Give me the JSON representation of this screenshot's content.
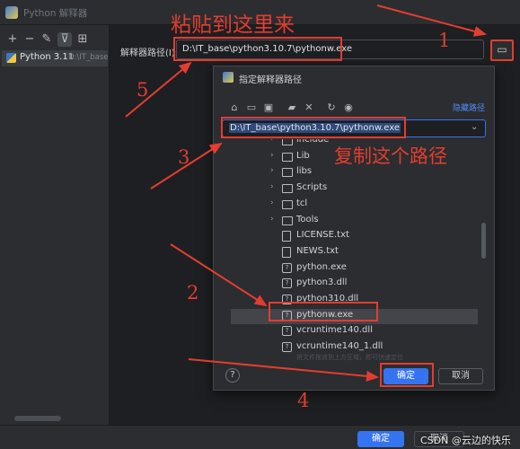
{
  "window": {
    "title": "Python 解释器"
  },
  "sidebar": {
    "interpreter": {
      "name": "Python 3.11",
      "path": "D:\\IT_base\\"
    }
  },
  "main": {
    "path_label": "解释器路径(I):",
    "path_value": "D:\\IT_base\\python3.10.7\\pythonw.exe"
  },
  "footer": {
    "ok_label": "确定",
    "cancel_label": "取消"
  },
  "dialog": {
    "title": "指定解释器路径",
    "hide_path_label": "隐藏路径",
    "path_value": "D:\\IT_base\\python3.10.7\\pythonw.exe",
    "hint": "将文件拖放到上方区域，即可快速定位",
    "ok_label": "确定",
    "cancel_label": "取消",
    "help_label": "?",
    "tree": [
      {
        "label": "include",
        "kind": "folder"
      },
      {
        "label": "Lib",
        "kind": "folder"
      },
      {
        "label": "libs",
        "kind": "folder"
      },
      {
        "label": "Scripts",
        "kind": "folder"
      },
      {
        "label": "tcl",
        "kind": "folder"
      },
      {
        "label": "Tools",
        "kind": "folder"
      },
      {
        "label": "LICENSE.txt",
        "kind": "file"
      },
      {
        "label": "NEWS.txt",
        "kind": "file"
      },
      {
        "label": "python.exe",
        "kind": "exe"
      },
      {
        "label": "python3.dll",
        "kind": "exe"
      },
      {
        "label": "python310.dll",
        "kind": "exe"
      },
      {
        "label": "pythonw.exe",
        "kind": "exe",
        "selected": true
      },
      {
        "label": "vcruntime140.dll",
        "kind": "exe"
      },
      {
        "label": "vcruntime140_1.dll",
        "kind": "exe"
      }
    ]
  },
  "annotations": {
    "paste_here": "粘贴到这里来",
    "copy_path": "复制这个路径",
    "step1": "1",
    "step2": "2",
    "step3": "3",
    "step4": "4",
    "step5": "5",
    "color": "#e33d30"
  },
  "watermark": "CSDN @云边的快乐猫",
  "colors": {
    "accent": "#3574f0",
    "background": "#1e1f22",
    "panel": "#2b2d30"
  }
}
